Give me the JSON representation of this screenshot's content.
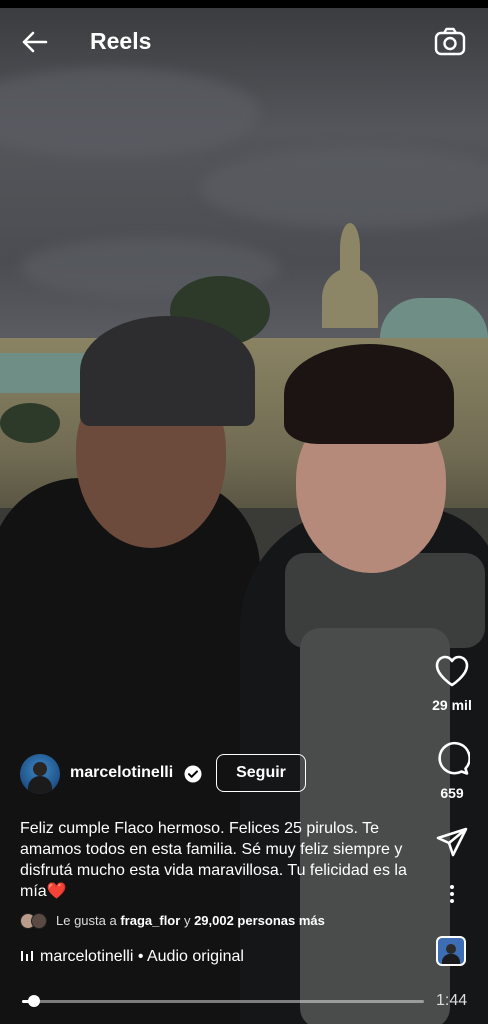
{
  "header": {
    "title": "Reels",
    "back_icon": "arrow-left-icon",
    "camera_icon": "camera-icon"
  },
  "rail": {
    "likes": {
      "icon": "heart-icon",
      "count": "29 mil"
    },
    "comments": {
      "icon": "comment-icon",
      "count": "659"
    },
    "share": {
      "icon": "send-icon"
    },
    "more": {
      "icon": "more-vertical-icon"
    }
  },
  "post": {
    "username": "marcelotinelli",
    "follow_label": "Seguir",
    "caption": "Feliz cumple Flaco hermoso. Felices 25 pirulos. Te amamos todos en esta familia. Sé muy feliz siempre y disfrutá mucho esta vida maravillosa. Tu felicidad es la mía❤️",
    "likes_prefix": "Le gusta a",
    "likes_user": "fraga_flor",
    "likes_mid": "y",
    "likes_count": "29,002 personas más",
    "audio": "marcelotinelli • Audio original"
  },
  "player": {
    "progress": 0.03,
    "duration": "1:44"
  },
  "colors": {
    "verified": "#ffffff",
    "follow_border": "#ffffff"
  }
}
